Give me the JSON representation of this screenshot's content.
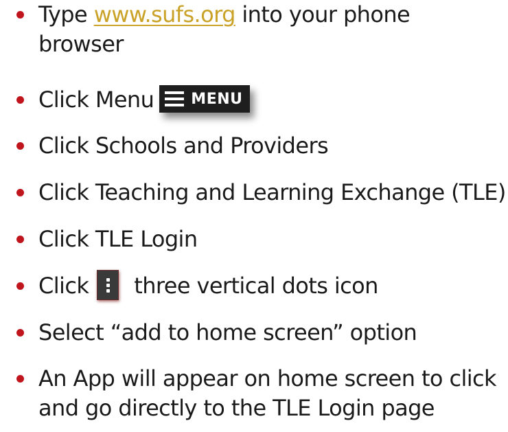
{
  "steps": [
    {
      "before": "Type ",
      "link": "www.sufs.org",
      "after": " into your phone"
    },
    {
      "line2": "browser"
    },
    {
      "text": "Click Menu",
      "badge_label": "MENU"
    },
    {
      "text": "Click Schools and Providers"
    },
    {
      "text": "Click Teaching and Learning Exchange (TLE)"
    },
    {
      "text": "Click TLE Login"
    },
    {
      "before": "Click",
      "after": "three vertical dots icon"
    },
    {
      "text": "Select “add to home screen” option"
    },
    {
      "line1": "An App will appear on home screen to click",
      "line2": "and go directly to the TLE Login page"
    }
  ],
  "colors": {
    "bullet": "#c0151c",
    "link": "#c9a227",
    "text": "#1a1a1a"
  },
  "icons": [
    "hamburger-menu-icon",
    "three-vertical-dots-icon"
  ]
}
